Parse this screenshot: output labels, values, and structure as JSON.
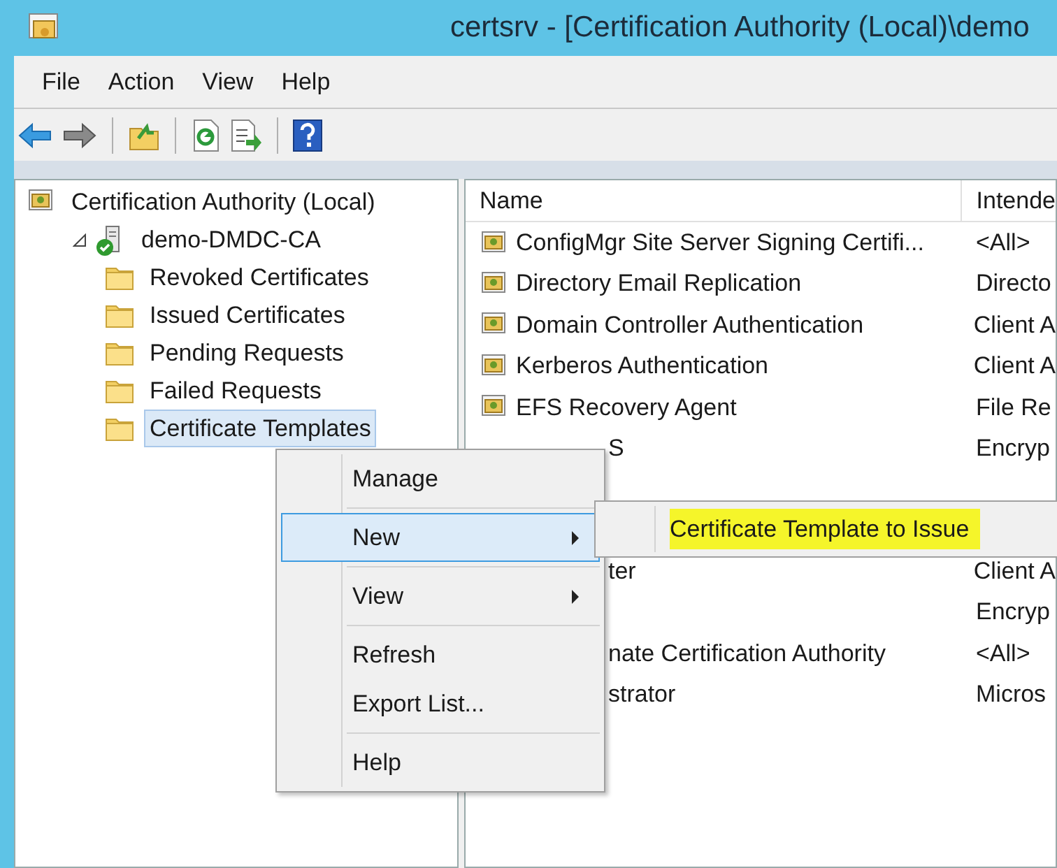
{
  "window": {
    "title": "certsrv - [Certification Authority (Local)\\demo"
  },
  "menu_bar": [
    "File",
    "Action",
    "View",
    "Help"
  ],
  "toolbar": [
    {
      "kind": "back",
      "disabled": false
    },
    {
      "kind": "forward",
      "disabled": true
    },
    {
      "kind": "up",
      "disabled": false
    },
    {
      "kind": "refresh",
      "disabled": false
    },
    {
      "kind": "export",
      "disabled": false
    },
    {
      "kind": "help",
      "disabled": false
    }
  ],
  "tree": [
    {
      "label": "Certification Authority (Local)",
      "kind": "root",
      "selected": false,
      "children": [
        {
          "label": "demo-DMDC-CA",
          "kind": "server",
          "expanded": true,
          "selected": false,
          "children": [
            {
              "label": "Revoked Certificates",
              "kind": "folder",
              "selected": false
            },
            {
              "label": "Issued Certificates",
              "kind": "folder",
              "selected": false
            },
            {
              "label": "Pending Requests",
              "kind": "folder",
              "selected": false
            },
            {
              "label": "Failed Requests",
              "kind": "folder",
              "selected": false
            },
            {
              "label": "Certificate Templates",
              "kind": "folder",
              "selected": true
            }
          ]
        }
      ]
    }
  ],
  "list": {
    "columns": [
      "Name",
      "Intende"
    ],
    "rows": [
      {
        "kind": "full",
        "name": "ConfigMgr Site Server Signing Certifi...",
        "column_2": "<All>"
      },
      {
        "kind": "full",
        "name": "Directory Email Replication",
        "column_2": "Directo"
      },
      {
        "kind": "full",
        "name": "Domain Controller Authentication",
        "column_2": "Client A"
      },
      {
        "kind": "full",
        "name": "Kerberos Authentication",
        "column_2": "Client A"
      },
      {
        "kind": "full",
        "name": "EFS Recovery Agent",
        "column_2": "File Re"
      },
      {
        "kind": "covered",
        "name": "S",
        "column_2": "Encryp"
      },
      {
        "kind": "hidden"
      },
      {
        "kind": "hidden"
      },
      {
        "kind": "covered",
        "name": "ter",
        "column_2": "Client A"
      },
      {
        "kind": "covered",
        "column_2": "Encryp"
      },
      {
        "kind": "covered",
        "name": "nate Certification Authority",
        "column_2": "<All>"
      },
      {
        "kind": "covered",
        "name": "strator",
        "column_2": "Micros"
      }
    ]
  },
  "context_menu": {
    "items": [
      {
        "kind": "item",
        "label": "Manage",
        "has_submenu": false,
        "selected": false
      },
      {
        "kind": "separator"
      },
      {
        "kind": "item",
        "label": "New",
        "has_submenu": true,
        "selected": true
      },
      {
        "kind": "separator"
      },
      {
        "kind": "item",
        "label": "View",
        "has_submenu": true,
        "selected": false
      },
      {
        "kind": "separator"
      },
      {
        "kind": "item",
        "label": "Refresh",
        "has_submenu": false,
        "selected": false
      },
      {
        "kind": "item",
        "label": "Export List...",
        "has_submenu": false,
        "selected": false
      },
      {
        "kind": "separator"
      },
      {
        "kind": "item",
        "label": "Help",
        "has_submenu": false,
        "selected": false
      }
    ]
  },
  "submenu": {
    "items": [
      {
        "label": "Certificate Template to Issue",
        "highlighted": true
      }
    ]
  }
}
